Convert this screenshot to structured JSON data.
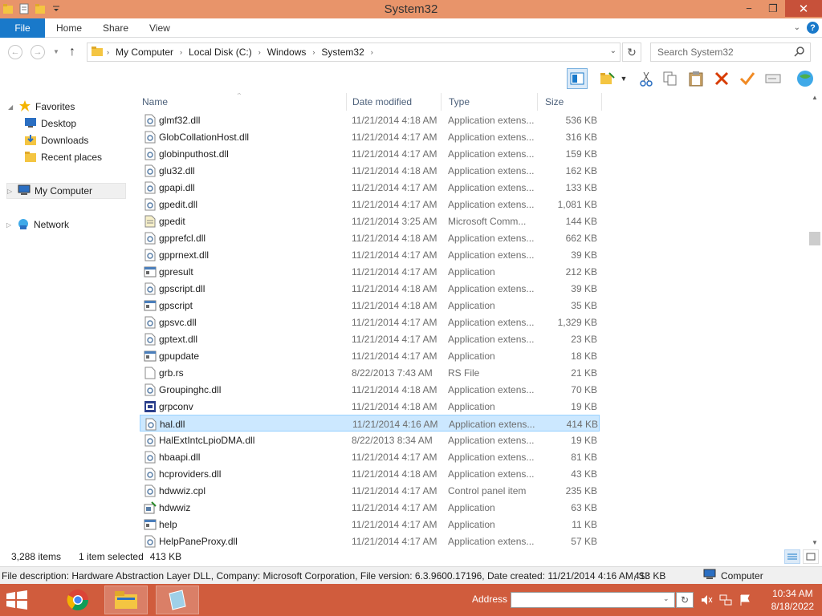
{
  "window": {
    "title": "System32",
    "minimize": "−",
    "maximize": "❐",
    "close": "✕"
  },
  "ribbon": {
    "file": "File",
    "home": "Home",
    "share": "Share",
    "view": "View"
  },
  "address": {
    "crumbs": [
      "My Computer",
      "Local Disk (C:)",
      "Windows",
      "System32"
    ],
    "search_placeholder": "Search System32"
  },
  "nav": {
    "favorites": "Favorites",
    "desktop": "Desktop",
    "downloads": "Downloads",
    "recent": "Recent places",
    "mycomputer": "My Computer",
    "network": "Network"
  },
  "columns": {
    "name": "Name",
    "date": "Date modified",
    "type": "Type",
    "size": "Size"
  },
  "files": [
    {
      "name": "glmf32.dll",
      "date": "11/21/2014 4:18 AM",
      "type": "Application extens...",
      "size": "536 KB",
      "icon": "dll-icon"
    },
    {
      "name": "GlobCollationHost.dll",
      "date": "11/21/2014 4:17 AM",
      "type": "Application extens...",
      "size": "316 KB",
      "icon": "dll-icon"
    },
    {
      "name": "globinputhost.dll",
      "date": "11/21/2014 4:17 AM",
      "type": "Application extens...",
      "size": "159 KB",
      "icon": "dll-icon"
    },
    {
      "name": "glu32.dll",
      "date": "11/21/2014 4:18 AM",
      "type": "Application extens...",
      "size": "162 KB",
      "icon": "dll-icon"
    },
    {
      "name": "gpapi.dll",
      "date": "11/21/2014 4:17 AM",
      "type": "Application extens...",
      "size": "133 KB",
      "icon": "dll-icon"
    },
    {
      "name": "gpedit.dll",
      "date": "11/21/2014 4:17 AM",
      "type": "Application extens...",
      "size": "1,081 KB",
      "icon": "dll-icon"
    },
    {
      "name": "gpedit",
      "date": "11/21/2014 3:25 AM",
      "type": "Microsoft Comm...",
      "size": "144 KB",
      "icon": "msc-icon"
    },
    {
      "name": "gpprefcl.dll",
      "date": "11/21/2014 4:18 AM",
      "type": "Application extens...",
      "size": "662 KB",
      "icon": "dll-icon"
    },
    {
      "name": "gpprnext.dll",
      "date": "11/21/2014 4:17 AM",
      "type": "Application extens...",
      "size": "39 KB",
      "icon": "dll-icon"
    },
    {
      "name": "gpresult",
      "date": "11/21/2014 4:17 AM",
      "type": "Application",
      "size": "212 KB",
      "icon": "exe-icon"
    },
    {
      "name": "gpscript.dll",
      "date": "11/21/2014 4:18 AM",
      "type": "Application extens...",
      "size": "39 KB",
      "icon": "dll-icon"
    },
    {
      "name": "gpscript",
      "date": "11/21/2014 4:18 AM",
      "type": "Application",
      "size": "35 KB",
      "icon": "exe-icon"
    },
    {
      "name": "gpsvc.dll",
      "date": "11/21/2014 4:17 AM",
      "type": "Application extens...",
      "size": "1,329 KB",
      "icon": "dll-icon"
    },
    {
      "name": "gptext.dll",
      "date": "11/21/2014 4:17 AM",
      "type": "Application extens...",
      "size": "23 KB",
      "icon": "dll-icon"
    },
    {
      "name": "gpupdate",
      "date": "11/21/2014 4:17 AM",
      "type": "Application",
      "size": "18 KB",
      "icon": "exe-icon"
    },
    {
      "name": "grb.rs",
      "date": "8/22/2013 7:43 AM",
      "type": "RS File",
      "size": "21 KB",
      "icon": "file-icon"
    },
    {
      "name": "Groupinghc.dll",
      "date": "11/21/2014 4:18 AM",
      "type": "Application extens...",
      "size": "70 KB",
      "icon": "dll-icon"
    },
    {
      "name": "grpconv",
      "date": "11/21/2014 4:18 AM",
      "type": "Application",
      "size": "19 KB",
      "icon": "grpconv-icon"
    },
    {
      "name": "hal.dll",
      "date": "11/21/2014 4:16 AM",
      "type": "Application extens...",
      "size": "414 KB",
      "icon": "dll-icon",
      "selected": true
    },
    {
      "name": "HalExtIntcLpioDMA.dll",
      "date": "8/22/2013 8:34 AM",
      "type": "Application extens...",
      "size": "19 KB",
      "icon": "dll-icon"
    },
    {
      "name": "hbaapi.dll",
      "date": "11/21/2014 4:17 AM",
      "type": "Application extens...",
      "size": "81 KB",
      "icon": "dll-icon"
    },
    {
      "name": "hcproviders.dll",
      "date": "11/21/2014 4:18 AM",
      "type": "Application extens...",
      "size": "43 KB",
      "icon": "dll-icon"
    },
    {
      "name": "hdwwiz.cpl",
      "date": "11/21/2014 4:17 AM",
      "type": "Control panel item",
      "size": "235 KB",
      "icon": "dll-icon"
    },
    {
      "name": "hdwwiz",
      "date": "11/21/2014 4:17 AM",
      "type": "Application",
      "size": "63 KB",
      "icon": "hdwwiz-icon"
    },
    {
      "name": "help",
      "date": "11/21/2014 4:17 AM",
      "type": "Application",
      "size": "11 KB",
      "icon": "exe-icon"
    },
    {
      "name": "HelpPaneProxy.dll",
      "date": "11/21/2014 4:17 AM",
      "type": "Application extens...",
      "size": "57 KB",
      "icon": "dll-icon"
    }
  ],
  "status": {
    "count": "3,288 items",
    "selected": "1 item selected",
    "size": "413 KB"
  },
  "desc": {
    "text": "File description: Hardware Abstraction Layer DLL, Company: Microsoft Corporation, File version: 6.3.9600.17196, Date created: 11/21/2014 4:16 AM, Si:",
    "size": "413 KB",
    "computer": "Computer"
  },
  "taskbar": {
    "address_label": "Address",
    "time": "10:34 AM",
    "date": "8/18/2022"
  },
  "colors": {
    "accent": "#1979ca",
    "titlebar": "#e8946a",
    "taskbar": "#d05c3d",
    "selection": "#cce8ff"
  }
}
